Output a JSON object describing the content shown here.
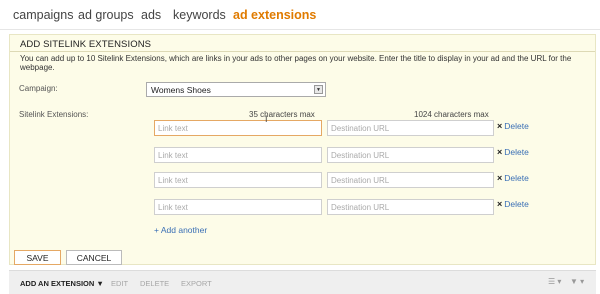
{
  "nav": {
    "tabs": [
      {
        "label": "campaigns",
        "active": false
      },
      {
        "label": "ad groups",
        "active": false
      },
      {
        "label": "ads",
        "active": false
      },
      {
        "label": "keywords",
        "active": false
      },
      {
        "label": "ad extensions",
        "active": true
      }
    ],
    "active_color": "#e07b00"
  },
  "panel": {
    "title": "ADD SITELINK EXTENSIONS",
    "description": "You can add up to 10 Sitelink Extensions, which are links in your ads to other pages on your website. Enter the title to display in your ad and the URL for the webpage.",
    "campaign_label": "Campaign:",
    "campaign_value": "Womens Shoes",
    "sitelinks_label": "Sitelink Extensions:",
    "link_text_hint": "35 characters max",
    "url_hint": "1024 characters max",
    "rows": [
      {
        "link_placeholder": "Link text",
        "url_placeholder": "Destination URL",
        "delete_label": "Delete"
      },
      {
        "link_placeholder": "Link text",
        "url_placeholder": "Destination URL",
        "delete_label": "Delete"
      },
      {
        "link_placeholder": "Link text",
        "url_placeholder": "Destination URL",
        "delete_label": "Delete"
      },
      {
        "link_placeholder": "Link text",
        "url_placeholder": "Destination URL",
        "delete_label": "Delete"
      }
    ],
    "delete_glyph": "×",
    "add_another_label": "+ Add another",
    "save_label": "SAVE",
    "cancel_label": "CANCEL",
    "background": "#fdfce8"
  },
  "toolbar": {
    "add_extension_label": "ADD AN EXTENSION ▼",
    "edit_label": "EDIT",
    "delete_label": "DELETE",
    "export_label": "EXPORT",
    "columns_icon": "columns-icon",
    "filter_icon": "filter-icon"
  },
  "colors": {
    "link": "#3a6fb5",
    "focus_border": "#e5a864"
  }
}
